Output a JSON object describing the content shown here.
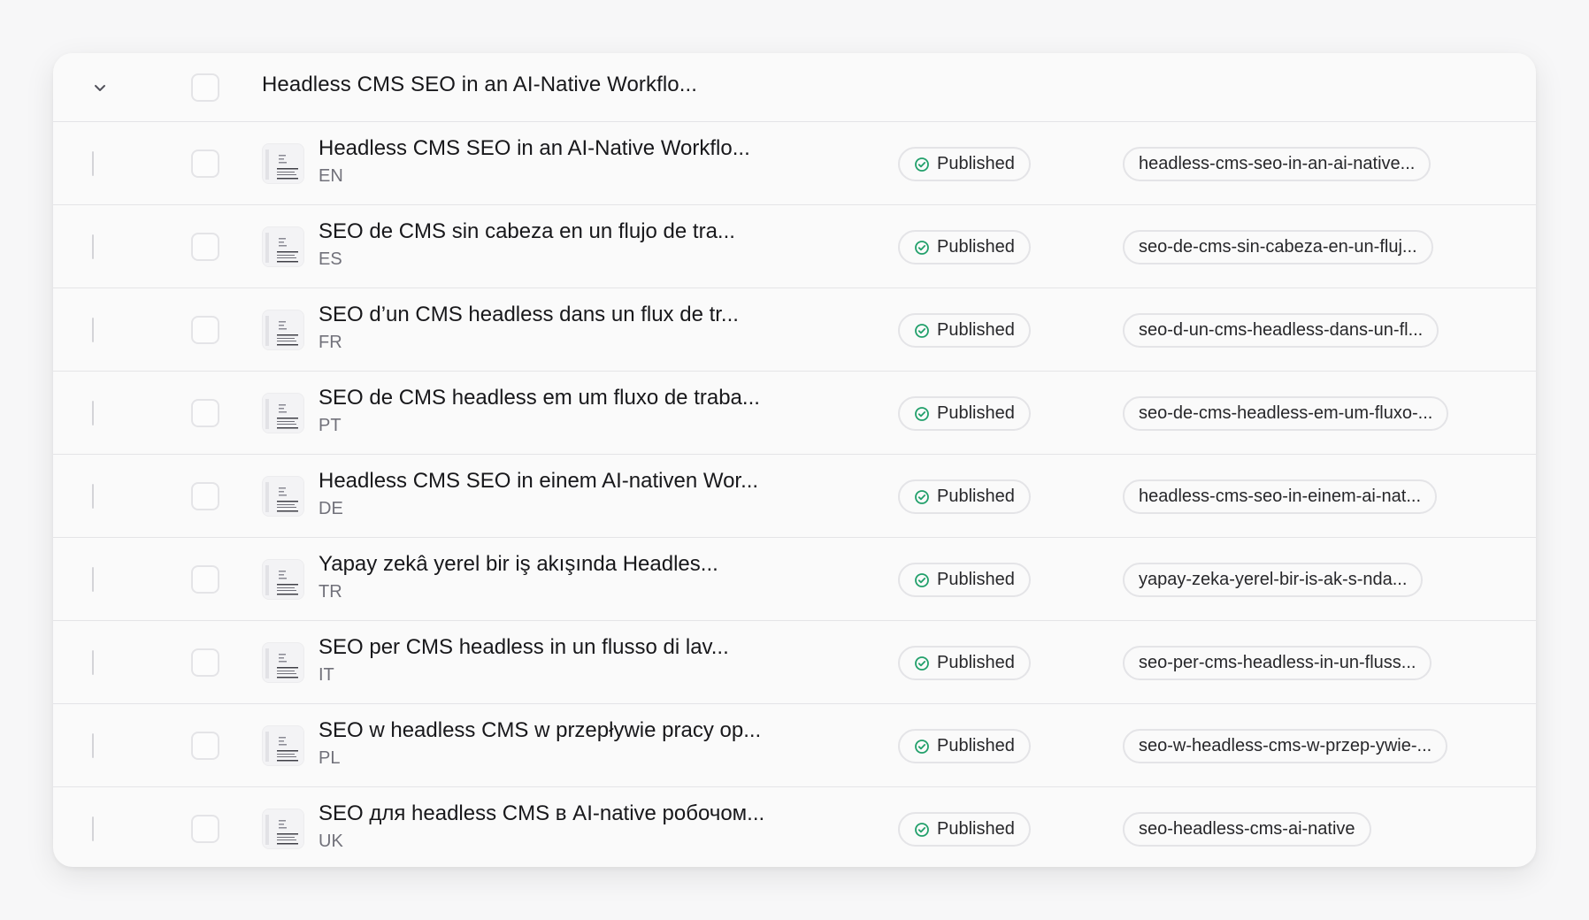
{
  "group": {
    "title": "Headless CMS SEO in an AI-Native Workflo..."
  },
  "colors": {
    "status_icon": "#22a06b",
    "border": "#e4e4e7",
    "muted_text": "#71717a"
  },
  "rows": [
    {
      "title": "Headless CMS SEO in an AI-Native Workflo...",
      "lang": "EN",
      "status": "Published",
      "slug": "headless-cms-seo-in-an-ai-native..."
    },
    {
      "title": "SEO de CMS sin cabeza en un flujo de tra...",
      "lang": "ES",
      "status": "Published",
      "slug": "seo-de-cms-sin-cabeza-en-un-fluj..."
    },
    {
      "title": "SEO d’un CMS headless dans un flux de tr...",
      "lang": "FR",
      "status": "Published",
      "slug": "seo-d-un-cms-headless-dans-un-fl..."
    },
    {
      "title": "SEO de CMS headless em um fluxo de traba...",
      "lang": "PT",
      "status": "Published",
      "slug": "seo-de-cms-headless-em-um-fluxo-..."
    },
    {
      "title": "Headless CMS SEO in einem AI-nativen Wor...",
      "lang": "DE",
      "status": "Published",
      "slug": "headless-cms-seo-in-einem-ai-nat..."
    },
    {
      "title": "Yapay zekâ yerel bir iş akışında Headles...",
      "lang": "TR",
      "status": "Published",
      "slug": "yapay-zeka-yerel-bir-is-ak-s-nda..."
    },
    {
      "title": "SEO per CMS headless in un flusso di lav...",
      "lang": "IT",
      "status": "Published",
      "slug": "seo-per-cms-headless-in-un-fluss..."
    },
    {
      "title": "SEO w headless CMS w przepływie pracy op...",
      "lang": "PL",
      "status": "Published",
      "slug": "seo-w-headless-cms-w-przep-ywie-..."
    },
    {
      "title": "SEO для headless CMS в AI-native робочом...",
      "lang": "UK",
      "status": "Published",
      "slug": "seo-headless-cms-ai-native"
    }
  ]
}
